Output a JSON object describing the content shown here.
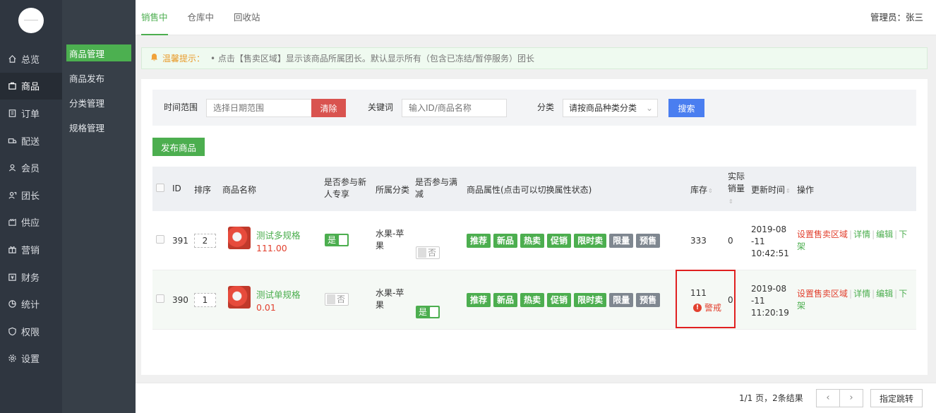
{
  "nav": {
    "items": [
      {
        "label": "总览",
        "icon": "home-icon"
      },
      {
        "label": "商品",
        "icon": "bag-icon",
        "active": true
      },
      {
        "label": "订单",
        "icon": "order-icon"
      },
      {
        "label": "配送",
        "icon": "truck-icon"
      },
      {
        "label": "会员",
        "icon": "user-icon"
      },
      {
        "label": "团长",
        "icon": "leader-icon"
      },
      {
        "label": "供应",
        "icon": "supply-icon"
      },
      {
        "label": "营销",
        "icon": "gift-icon"
      },
      {
        "label": "财务",
        "icon": "finance-icon"
      },
      {
        "label": "统计",
        "icon": "chart-icon"
      },
      {
        "label": "权限",
        "icon": "shield-icon"
      },
      {
        "label": "设置",
        "icon": "gear-icon"
      }
    ]
  },
  "subnav": {
    "items": [
      "商品管理",
      "商品发布",
      "分类管理",
      "规格管理"
    ],
    "active": "商品管理"
  },
  "header": {
    "tabs": [
      "销售中",
      "仓库中",
      "回收站"
    ],
    "active_tab": "销售中",
    "admin": "管理员：张三"
  },
  "notice": {
    "label": "温馨提示：",
    "text": "•    点击【售卖区域】显示该商品所属团长。默认显示所有（包含已冻结/暂停服务）团长"
  },
  "filter": {
    "date_label": "时间范围",
    "date_placeholder": "选择日期范围",
    "clear_label": "清除",
    "keyword_label": "关键词",
    "keyword_placeholder": "输入ID/商品名称",
    "category_label": "分类",
    "category_value": "请按商品种类分类",
    "search_label": "搜索"
  },
  "publish_label": "发布商品",
  "table": {
    "headers": {
      "id": "ID",
      "order": "排序",
      "name": "商品名称",
      "newbie": "是否参与新人专享",
      "category": "所属分类",
      "full_reduce": "是否参与满减",
      "attrs": "商品属性(点击可以切换属性状态)",
      "stock": "库存",
      "sales": "实际销量",
      "updated": "更新时间",
      "ops": "操作"
    },
    "rows": [
      {
        "id": "391",
        "order": "2",
        "name": "测试多规格",
        "price": "111.00",
        "newbie": "是",
        "category": "水果-苹果",
        "full_reduce": "否",
        "tags": [
          "推荐",
          "新品",
          "热卖",
          "促销",
          "限时卖",
          "限量",
          "预售"
        ],
        "stock": "333",
        "sales": "0",
        "date": "2019-08-11",
        "time": "10:42:51",
        "warn": ""
      },
      {
        "id": "390",
        "order": "1",
        "name": "测试单规格",
        "price": "0.01",
        "newbie": "否",
        "category": "水果-苹果",
        "full_reduce": "是",
        "tags": [
          "推荐",
          "新品",
          "热卖",
          "促销",
          "限时卖",
          "限量",
          "预售"
        ],
        "stock": "111",
        "sales": "0",
        "date": "2019-08-11",
        "time": "11:20:19",
        "warn": "警戒"
      }
    ],
    "ops": {
      "area": "设置售卖区域",
      "detail": "详情",
      "edit": "编辑",
      "off": "下架"
    }
  },
  "pager": {
    "info": "1/1 页，2条结果",
    "prev": "‹",
    "next": "›",
    "jump_label": "指定跳转"
  }
}
